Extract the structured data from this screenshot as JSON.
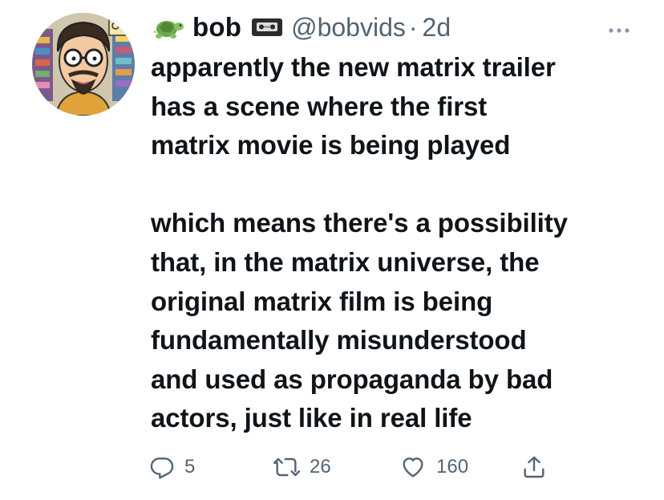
{
  "tweet": {
    "display_name": "bob",
    "handle": "@bobvids",
    "separator": "·",
    "time": "2d",
    "name_emoji": "turtle-emoji",
    "badge_icon": "videocassette-emoji",
    "text_lines": [
      "apparently the new matrix trailer",
      "has a scene where the first",
      "matrix movie is being played",
      "",
      "which means there's a possibility",
      "that, in the matrix universe, the",
      "original matrix film is being",
      "fundamentally misunderstood",
      "and used as propaganda by bad",
      "actors, just like in real life"
    ],
    "actions": {
      "replies": "5",
      "retweets": "26",
      "likes": "160"
    }
  },
  "colors": {
    "text": "#0f1419",
    "secondary": "#536471",
    "background": "#ffffff"
  }
}
